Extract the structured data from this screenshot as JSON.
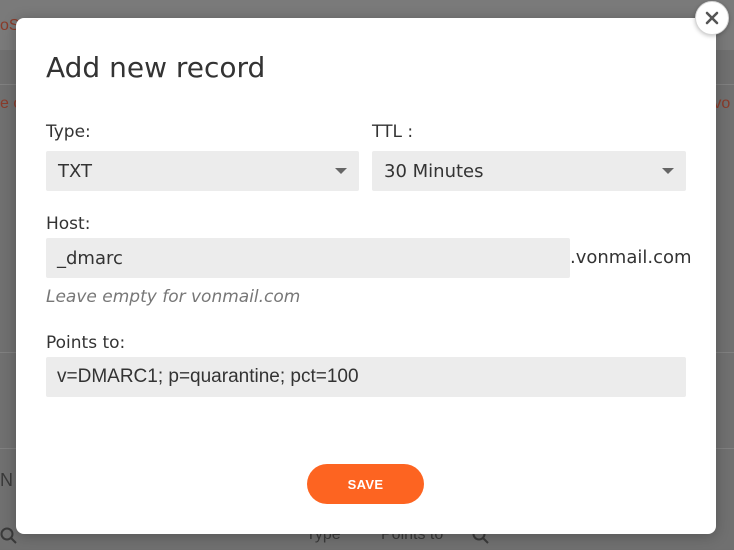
{
  "modal": {
    "title": "Add new record",
    "close_icon": "close-icon",
    "type": {
      "label": "Type:",
      "value": "TXT",
      "icon": "chevron-down-icon"
    },
    "ttl": {
      "label": "TTL :",
      "value": "30 Minutes",
      "icon": "chevron-down-icon"
    },
    "host": {
      "label": "Host:",
      "value": "_dmarc",
      "suffix": ".vonmail.com",
      "hint": "Leave empty for vonmail.com"
    },
    "points_to": {
      "label": "Points to:",
      "value": "v=DMARC1; p=quarantine; pct=100"
    },
    "save_label": "SAVE",
    "colors": {
      "accent": "#fd6421",
      "field_bg": "#ececec",
      "text": "#333333",
      "hint": "#777777"
    }
  },
  "background": {
    "fragments": [
      "oS",
      "e o",
      "e vo",
      "N",
      "Type",
      "Points to"
    ],
    "icons": [
      "search-icon",
      "search-icon"
    ]
  }
}
